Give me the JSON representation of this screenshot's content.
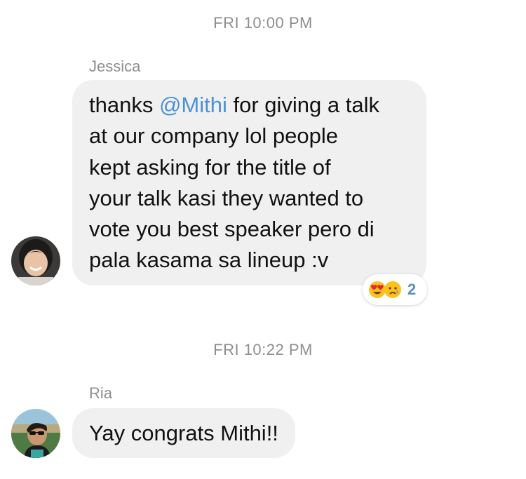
{
  "thread": {
    "timestamp_1": "FRI 10:00 PM",
    "timestamp_2": "FRI 10:22 PM"
  },
  "messages": [
    {
      "sender": "Jessica",
      "lines": [
        [
          "thanks ",
          "@Mithi",
          " for giving a talk"
        ],
        "at our company lol people",
        "kept asking for the title of",
        "your talk kasi they wanted to",
        "vote you best speaker pero di",
        "pala kasama sa lineup :v"
      ],
      "reactions": {
        "icons": [
          "heart-eyes-emoji-icon",
          "crying-emoji-icon"
        ],
        "count": "2"
      }
    },
    {
      "sender": "Ria",
      "text": "Yay congrats Mithi!!"
    }
  ],
  "colors": {
    "bubble": "#f0f0f0",
    "mention": "#4a90d9",
    "meta_text": "#8e8e93",
    "reaction_count": "#5a8fbf"
  }
}
